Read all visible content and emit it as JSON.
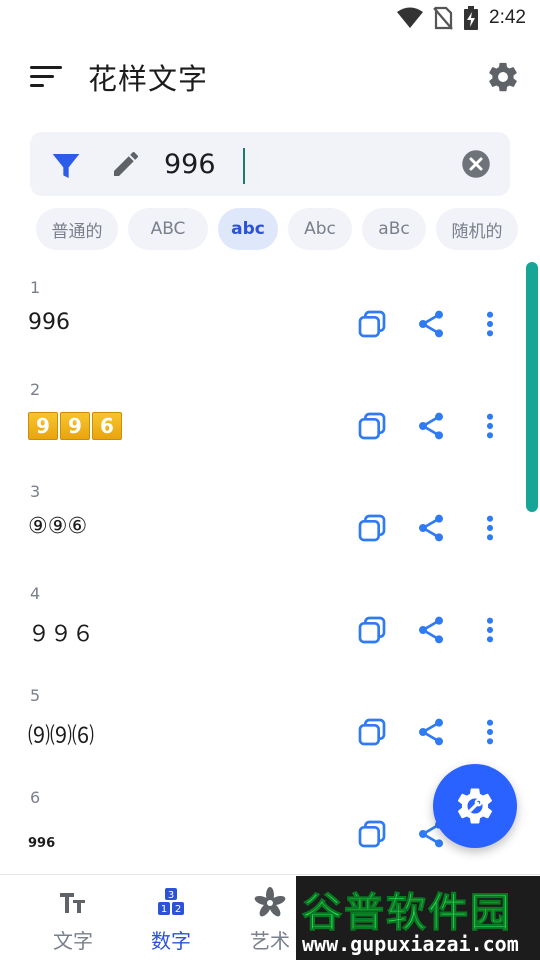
{
  "status_bar": {
    "time": "2:42"
  },
  "app_bar": {
    "title": "花样文字"
  },
  "input": {
    "value": "996"
  },
  "chips": [
    {
      "label": "普通的",
      "active": false
    },
    {
      "label": "ABC",
      "active": false
    },
    {
      "label": "abc",
      "active": true
    },
    {
      "label": "Abc",
      "active": false
    },
    {
      "label": "aBc",
      "active": false
    },
    {
      "label": "随机的",
      "active": false
    }
  ],
  "results": [
    {
      "index": "1",
      "text": "996"
    },
    {
      "index": "2",
      "text": "996",
      "keycaps": [
        "9",
        "9",
        "6"
      ]
    },
    {
      "index": "3",
      "text": "⑨⑨⑥"
    },
    {
      "index": "4",
      "text": "９９６"
    },
    {
      "index": "5",
      "text": "⑼⑼⑹"
    },
    {
      "index": "6",
      "text": "996"
    }
  ],
  "bottom_nav": {
    "items": [
      {
        "label": "文字",
        "icon": "text-style-icon",
        "active": false
      },
      {
        "label": "数字",
        "icon": "number-blocks-icon",
        "active": true
      },
      {
        "label": "艺术",
        "icon": "flower-icon",
        "active": false
      }
    ]
  },
  "watermark": {
    "title": "谷普软件园",
    "url": "www.gupuxiazai.com"
  },
  "colors": {
    "accent": "#2962ff",
    "chip_active_bg": "#dfe7fb",
    "chip_active_text": "#2c53d6",
    "icon_blue": "#2f7bf5",
    "scrollbar": "#16a596",
    "keycap": "#f2b41c"
  }
}
